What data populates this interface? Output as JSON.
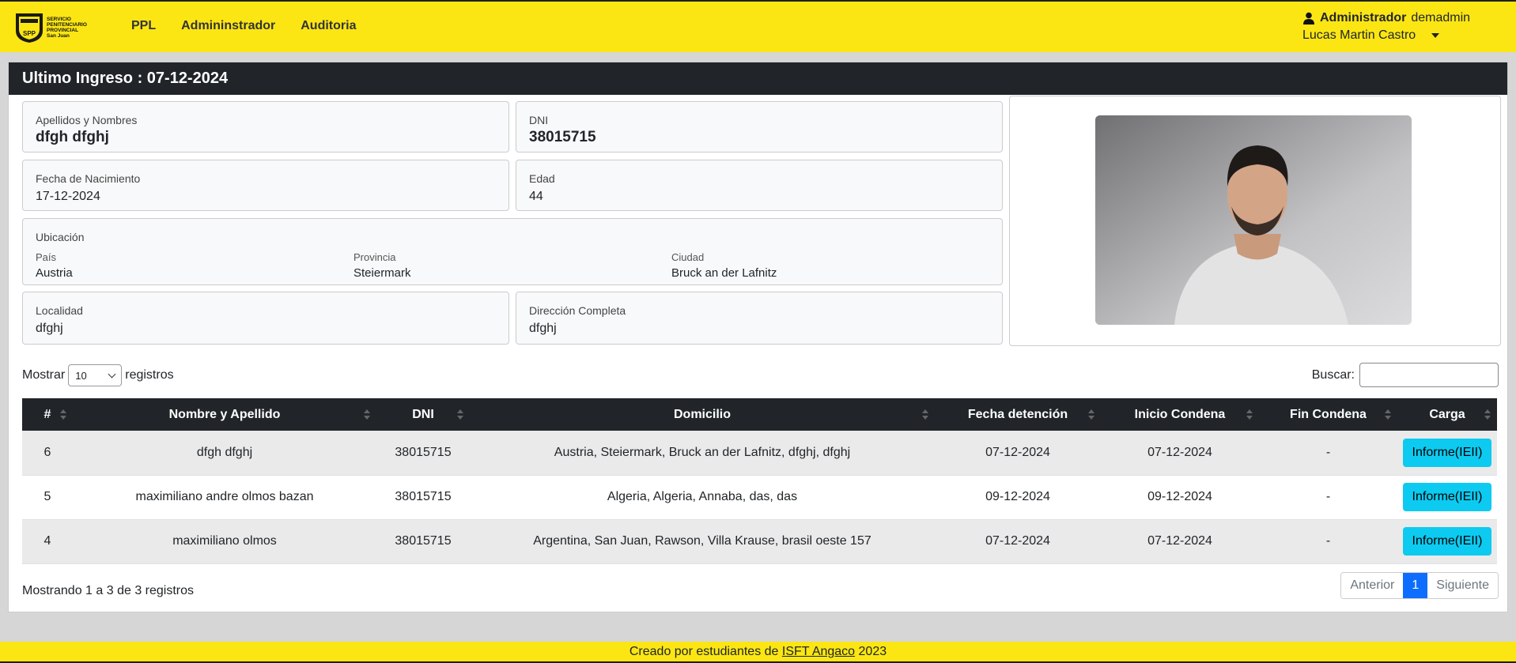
{
  "nav": {
    "logo_lines": [
      "SERVICIO",
      "PENITENCIARIO",
      "PROVINCIAL",
      "San Juan"
    ],
    "logo_badge": "SPP",
    "links": [
      "PPL",
      "Admininstrador",
      "Auditoria"
    ]
  },
  "user": {
    "role": "Administrador",
    "username": "demadmin",
    "full_name": "Lucas Martin Castro"
  },
  "card": {
    "header": "Ultimo Ingreso : 07-12-2024",
    "apellidos_label": "Apellidos y Nombres",
    "apellidos_value": "dfgh dfghj",
    "dni_label": "DNI",
    "dni_value": "38015715",
    "nacimiento_label": "Fecha de Nacimiento",
    "nacimiento_value": "17-12-2024",
    "edad_label": "Edad",
    "edad_value": "44",
    "ubicacion_label": "Ubicación",
    "pais_label": "País",
    "pais_value": "Austria",
    "provincia_label": "Provincia",
    "provincia_value": "Steiermark",
    "ciudad_label": "Ciudad",
    "ciudad_value": "Bruck an der Lafnitz",
    "localidad_label": "Localidad",
    "localidad_value": "dfghj",
    "direccion_label": "Dirección Completa",
    "direccion_value": "dfghj"
  },
  "table_controls": {
    "show_label": "Mostrar",
    "show_value": "10",
    "records_label": "registros",
    "search_label": "Buscar:"
  },
  "table": {
    "headers": [
      "#",
      "Nombre y Apellido",
      "DNI",
      "Domicilio",
      "Fecha detención",
      "Inicio Condena",
      "Fin Condena",
      "Carga"
    ],
    "rows": [
      {
        "num": "6",
        "nombre": "dfgh dfghj",
        "dni": "38015715",
        "domicilio": "Austria, Steiermark, Bruck an der Lafnitz, dfghj, dfghj",
        "fecha": "07-12-2024",
        "inicio": "07-12-2024",
        "fin": "-",
        "carga": "Informe(IEII)"
      },
      {
        "num": "5",
        "nombre": "maximiliano andre olmos bazan",
        "dni": "38015715",
        "domicilio": "Algeria, Algeria, Annaba, das, das",
        "fecha": "09-12-2024",
        "inicio": "09-12-2024",
        "fin": "-",
        "carga": "Informe(IEII)"
      },
      {
        "num": "4",
        "nombre": "maximiliano olmos",
        "dni": "38015715",
        "domicilio": "Argentina, San Juan, Rawson, Villa Krause, brasil oeste 157",
        "fecha": "07-12-2024",
        "inicio": "07-12-2024",
        "fin": "-",
        "carga": "Informe(IEII)"
      }
    ]
  },
  "pagination": {
    "info": "Mostrando 1 a 3 de 3 registros",
    "prev": "Anterior",
    "page": "1",
    "next": "Siguiente"
  },
  "footer": {
    "prefix": "Creado por estudiantes de ",
    "link": "ISFT Angaco",
    "year": " 2023"
  },
  "colors": {
    "navbar": "#fbe614",
    "dark": "#212529",
    "info_button": "#0dcaf0",
    "primary": "#0d6efd"
  }
}
